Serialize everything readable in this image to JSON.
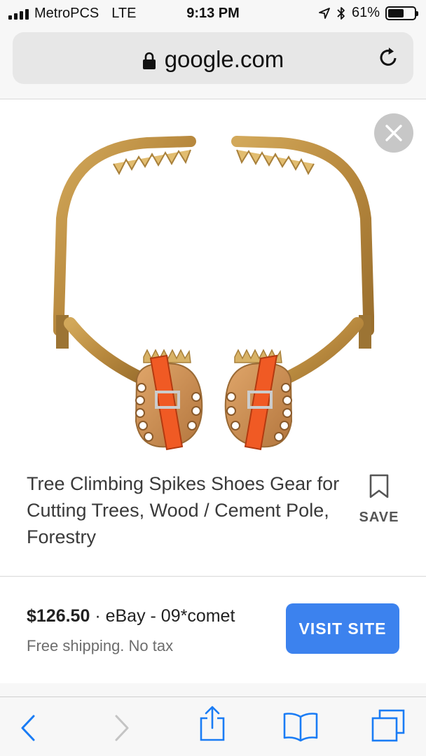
{
  "status_bar": {
    "carrier": "MetroPCS",
    "network": "LTE",
    "time": "9:13 PM",
    "battery": "61%",
    "battery_level": 0.61,
    "icons": [
      "signal-icon",
      "location-arrow-icon",
      "bluetooth-icon",
      "battery-icon"
    ]
  },
  "browser": {
    "url": "google.com",
    "icons": [
      "lock-icon",
      "reload-icon"
    ]
  },
  "result": {
    "title": "Tree Climbing Spikes Shoes Gear for Cutting Trees, Wood / Cement Pole, Forestry",
    "save_label": "SAVE",
    "price": "$126.50",
    "seller": "eBay - 09*comet",
    "separator": " · ",
    "shipping": "Free shipping. No tax",
    "visit_label": "VISIT SITE"
  },
  "toolbar": {
    "icons": [
      "back-icon",
      "forward-icon",
      "share-icon",
      "bookmarks-icon",
      "tabs-icon"
    ]
  },
  "colors": {
    "accent": "#3c82ee",
    "ios_blue": "#1a7cf5",
    "disabled": "#c4c4c4",
    "close_bg": "#c7c7c7"
  }
}
